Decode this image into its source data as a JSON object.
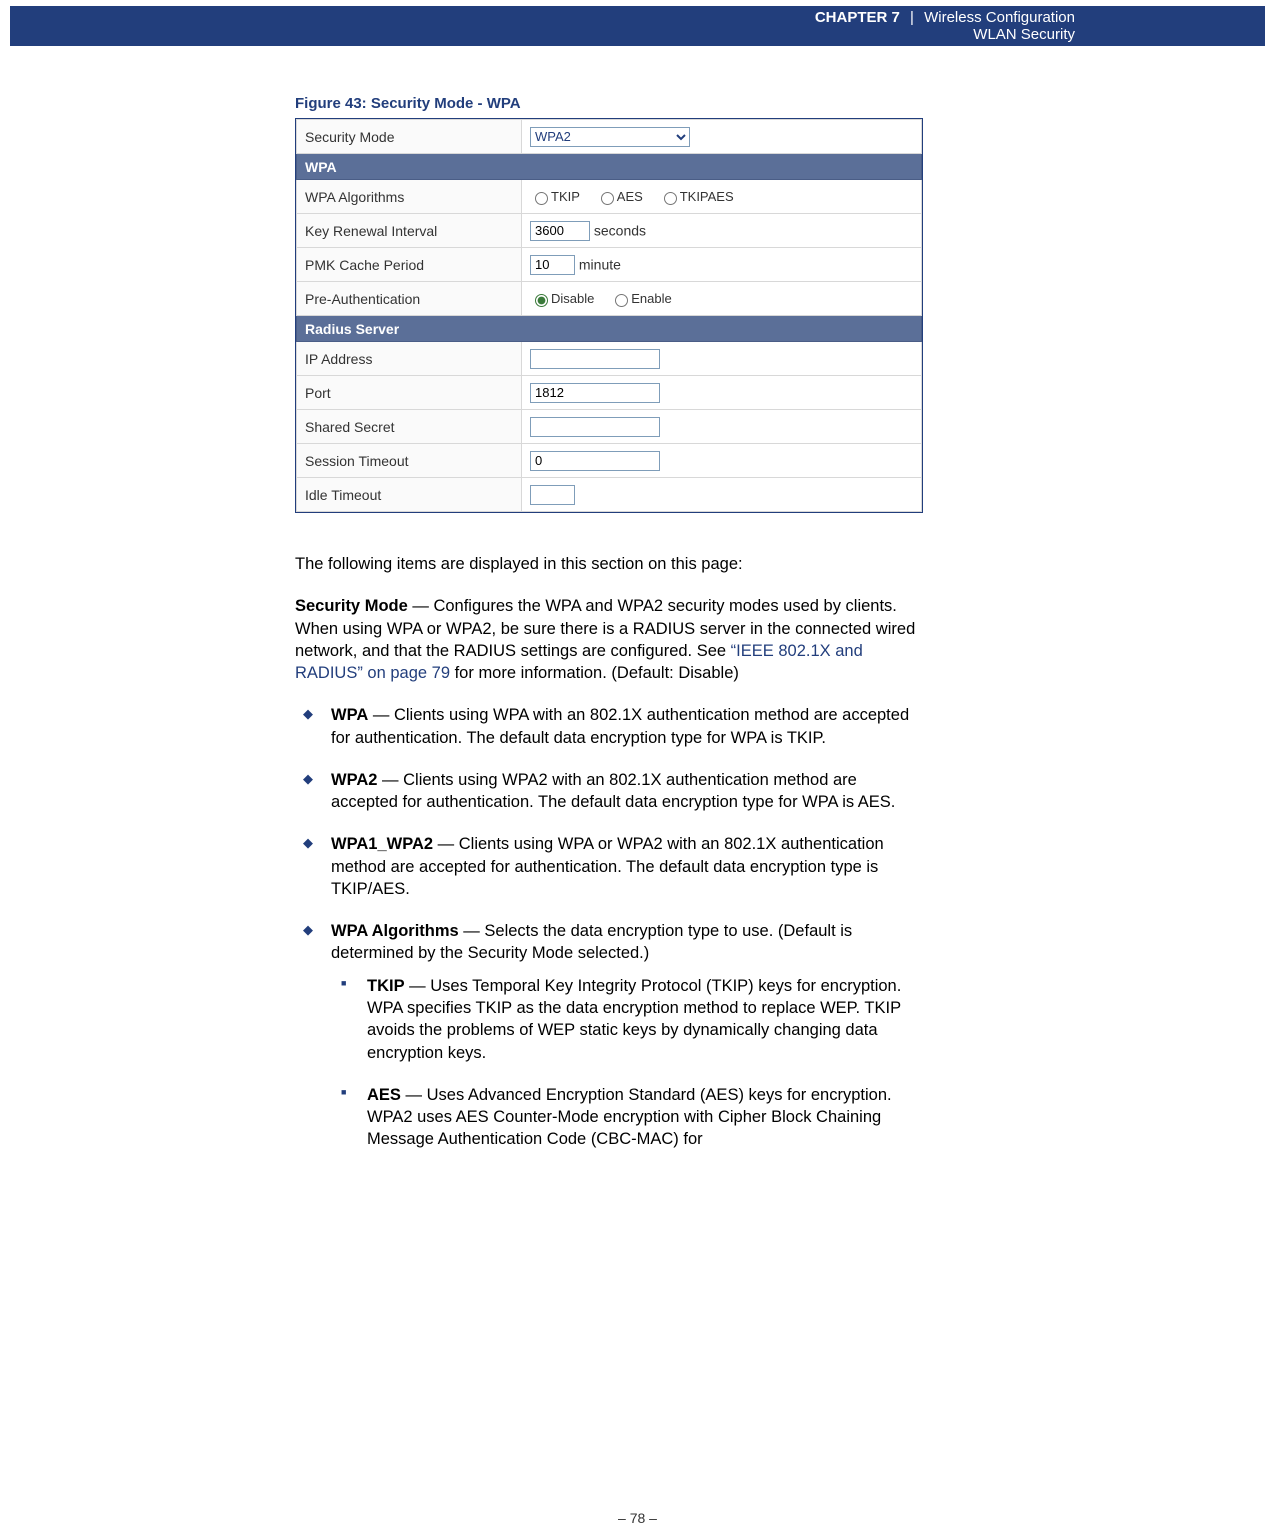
{
  "header": {
    "chapter_label": "CHAPTER 7",
    "pipe": "|",
    "chapter_title": "Wireless Configuration",
    "subtitle": "WLAN Security"
  },
  "figure": {
    "caption": "Figure 43:  Security Mode - WPA",
    "security_mode": {
      "label": "Security Mode",
      "value": "WPA2"
    },
    "wpa_section": "WPA",
    "wpa_algorithms": {
      "label": "WPA Algorithms",
      "opt_tkip": "TKIP",
      "opt_aes": "AES",
      "opt_tkipaes": "TKIPAES"
    },
    "key_renewal": {
      "label": "Key Renewal Interval",
      "value": "3600",
      "unit": "seconds"
    },
    "pmk_cache": {
      "label": "PMK Cache Period",
      "value": "10",
      "unit": "minute"
    },
    "preauth": {
      "label": "Pre-Authentication",
      "disable": "Disable",
      "enable": "Enable"
    },
    "radius_section": "Radius Server",
    "ip": {
      "label": "IP Address",
      "value": ""
    },
    "port": {
      "label": "Port",
      "value": "1812"
    },
    "secret": {
      "label": "Shared Secret",
      "value": ""
    },
    "session_timeout": {
      "label": "Session Timeout",
      "value": "0"
    },
    "idle_timeout": {
      "label": "Idle Timeout",
      "value": ""
    }
  },
  "body": {
    "intro": "The following items are displayed in this section on this page:",
    "secmode_para1": "Security Mode",
    "secmode_para2": " — Configures the WPA and WPA2 security modes used by clients. When using WPA or WPA2, be sure there is a RADIUS server in the connected wired network, and that the RADIUS settings are configured. See ",
    "secmode_link": "“IEEE 802.1X and RADIUS” on page 79",
    "secmode_para3": " for more information. (Default: Disable)",
    "wpa_b": "WPA",
    "wpa_t": " — Clients using WPA with an 802.1X authentication method are accepted for authentication. The default data encryption type for WPA is TKIP.",
    "wpa2_b": "WPA2",
    "wpa2_t": " — Clients using WPA2 with an 802.1X authentication method are accepted for authentication. The default data encryption type for WPA is AES.",
    "wpa12_b": "WPA1_WPA2",
    "wpa12_t": " — Clients using WPA or WPA2 with an 802.1X authentication method are accepted for authentication. The default data encryption type is TKIP/AES.",
    "alg_b": "WPA Algorithms",
    "alg_t": " — Selects the data encryption type to use. (Default is determined by the Security Mode selected.)",
    "tkip_b": "TKIP",
    "tkip_t": " — Uses Temporal Key Integrity Protocol (TKIP) keys for encryption. WPA specifies TKIP as the data encryption method to replace WEP. TKIP avoids the problems of WEP static keys by dynamically changing data encryption keys.",
    "aes_b": "AES",
    "aes_t": " — Uses Advanced Encryption Standard (AES) keys for encryption. WPA2 uses AES Counter-Mode encryption with Cipher Block Chaining Message Authentication Code (CBC-MAC) for"
  },
  "footer": {
    "page": "–  78  –"
  }
}
